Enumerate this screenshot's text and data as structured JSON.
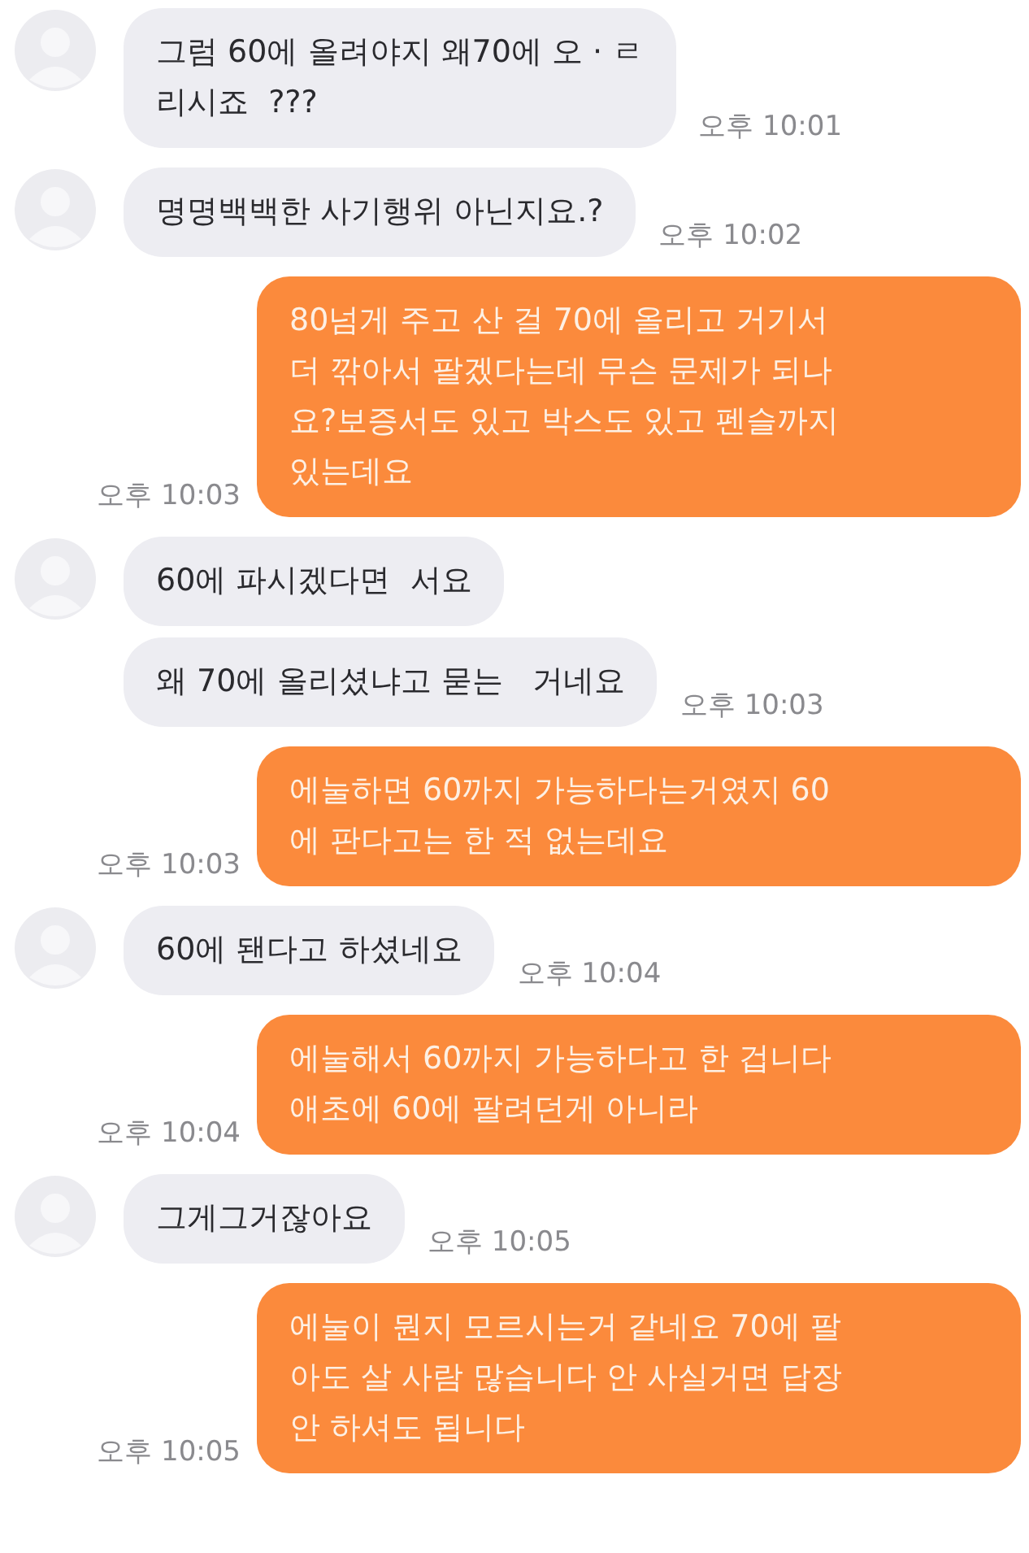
{
  "messages": [
    {
      "kind": "received",
      "avatar": true,
      "lines": [
        "그럼 60에 올려야지 왜70에 오 · ㄹ",
        "리시죠  ???"
      ],
      "time": "오후 10:01"
    },
    {
      "kind": "received",
      "avatar": true,
      "lines": [
        "명명백백한 사기행위 아닌지요.?"
      ],
      "time": "오후 10:02"
    },
    {
      "kind": "sent",
      "lines": [
        "80넘게 주고 산 걸 70에 올리고 거기서",
        "더 깎아서 팔겠다는데 무슨 문제가 되나",
        "요?보증서도 있고 박스도 있고 펜슬까지",
        "있는데요"
      ],
      "time": "오후 10:03"
    },
    {
      "kind": "received",
      "avatar": true,
      "lines": [
        "60에 파시겠다면  서요"
      ]
    },
    {
      "kind": "received",
      "avatar": false,
      "lines": [
        "왜 70에 올리셨냐고 묻는   거네요"
      ],
      "time": "오후 10:03"
    },
    {
      "kind": "sent",
      "lines": [
        "에눌하면 60까지 가능하다는거였지 60",
        "에 판다고는 한 적 없는데요"
      ],
      "time": "오후 10:03"
    },
    {
      "kind": "received",
      "avatar": true,
      "lines": [
        "60에 됀다고 하셨네요"
      ],
      "time": "오후 10:04"
    },
    {
      "kind": "sent",
      "lines": [
        "에눌해서 60까지 가능하다고 한 겁니다",
        "애초에 60에 팔려던게 아니라"
      ],
      "time": "오후 10:04"
    },
    {
      "kind": "received",
      "avatar": true,
      "lines": [
        "그게그거잖아요"
      ],
      "time": "오후 10:05"
    },
    {
      "kind": "sent",
      "lines": [
        "에눌이 뭔지 모르시는거 같네요 70에 팔",
        "아도 살 사람 많습니다 안 사실거면 답장",
        "안 하셔도 됩니다"
      ],
      "time": "오후 10:05"
    }
  ]
}
